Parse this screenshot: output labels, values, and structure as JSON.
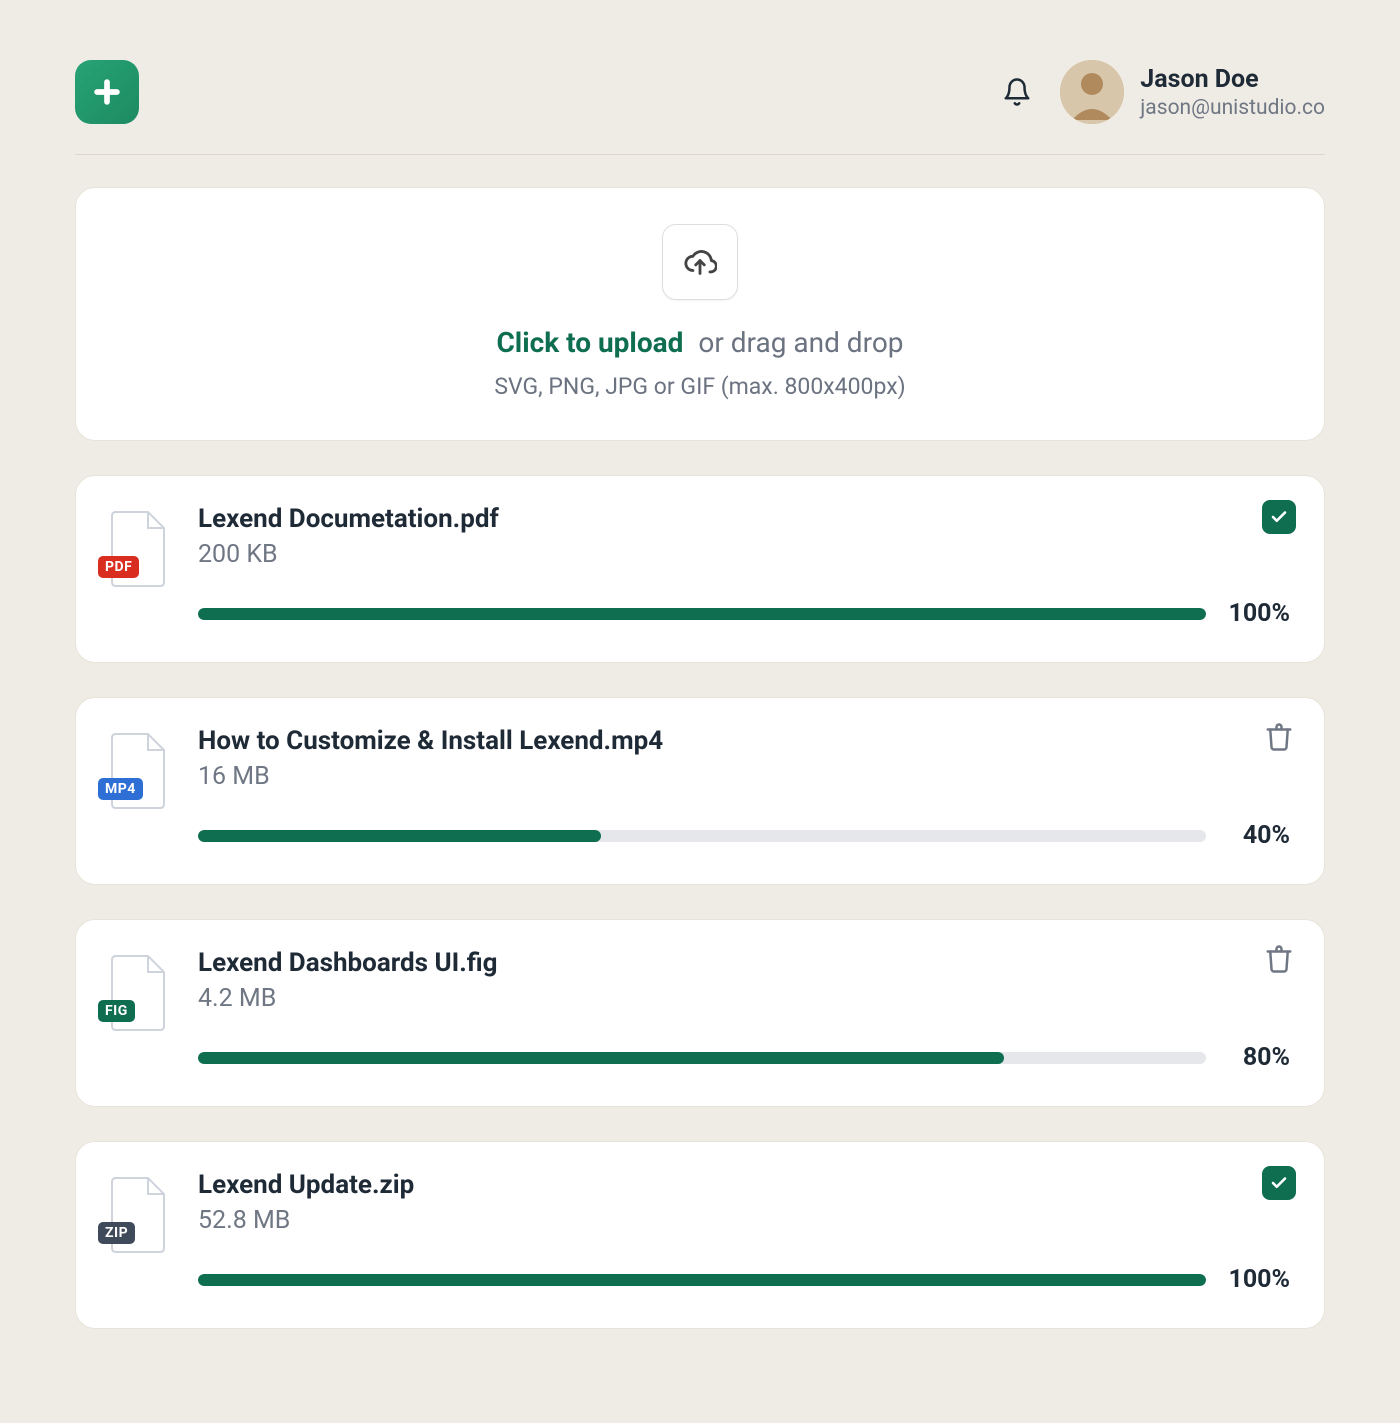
{
  "user": {
    "name": "Jason Doe",
    "email": "jason@unistudio.co"
  },
  "upload": {
    "cta": "Click to upload",
    "drag_text": "or drag and drop",
    "hint": "SVG, PNG, JPG or GIF (max. 800x400px)"
  },
  "files": [
    {
      "name": "Lexend Documetation.pdf",
      "size": "200 KB",
      "ext": "PDF",
      "ext_color": "#d92d20",
      "progress": 100,
      "progress_label": "100%",
      "complete": true
    },
    {
      "name": "How to Customize & Install Lexend.mp4",
      "size": "16 MB",
      "ext": "MP4",
      "ext_color": "#2e6fd6",
      "progress": 40,
      "progress_label": "40%",
      "complete": false
    },
    {
      "name": "Lexend Dashboards UI.fig",
      "size": "4.2 MB",
      "ext": "FIG",
      "ext_color": "#0f6e50",
      "progress": 80,
      "progress_label": "80%",
      "complete": false
    },
    {
      "name": "Lexend Update.zip",
      "size": "52.8 MB",
      "ext": "ZIP",
      "ext_color": "#3f4a5a",
      "progress": 100,
      "progress_label": "100%",
      "complete": true
    }
  ]
}
